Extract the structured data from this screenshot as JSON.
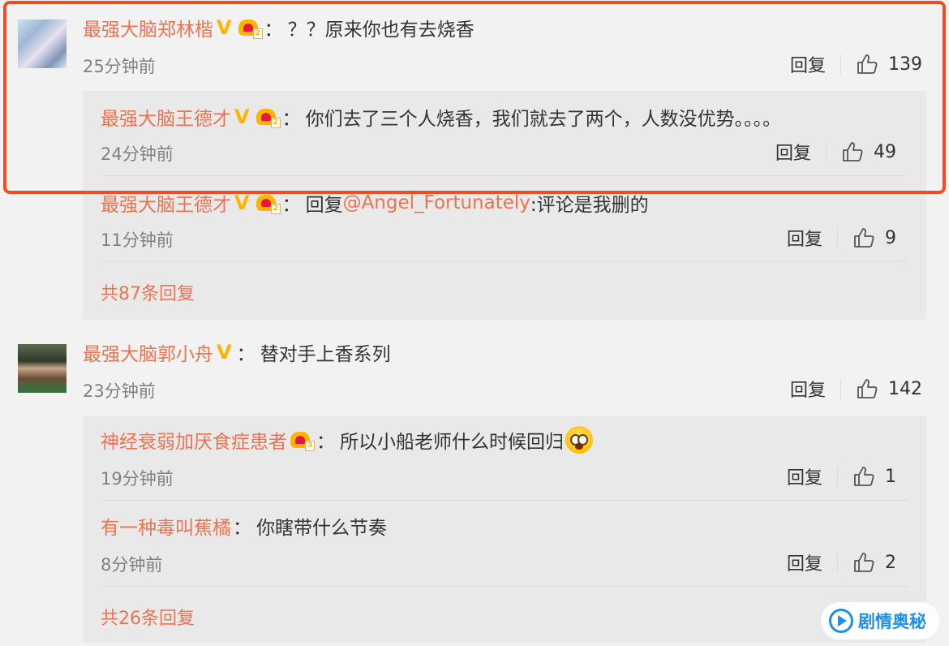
{
  "ui": {
    "reply_label": "回复",
    "colon": "："
  },
  "comments": [
    {
      "user": "最强大脑郑林楷",
      "text": "？？原来你也有去烧香",
      "time": "25分钟前",
      "likes": "139",
      "badges": [
        "v-badge",
        "crown-lv2-icon"
      ],
      "replies": [
        {
          "user": "最强大脑王德才",
          "text": "你们去了三个人烧香，我们就去了两个，人数没优势。。。。",
          "time": "24分钟前",
          "likes": "49"
        },
        {
          "user": "最强大脑王德才",
          "reply_prefix": "回复",
          "mention": "@Angel_Fortunately",
          "text": ":评论是我删的",
          "time": "11分钟前",
          "likes": "9"
        }
      ],
      "more": "共87条回复"
    },
    {
      "user": "最强大脑郭小舟",
      "text": "替对手上香系列",
      "time": "23分钟前",
      "likes": "142",
      "badges": [
        "v-badge"
      ],
      "replies": [
        {
          "user": "神经衰弱加厌食症患者",
          "text": "所以小船老师什么时候回归",
          "time": "19分钟前",
          "likes": "1",
          "emoji": "scared-face-icon"
        },
        {
          "user": "有一种毒叫蕉橘",
          "text": "你瞎带什么节奏",
          "time": "8分钟前",
          "likes": "2"
        }
      ],
      "more": "共26条回复"
    }
  ],
  "watermark": {
    "text": "剧情奥秘"
  },
  "colors": {
    "name": "#eb7350",
    "highlight_border": "#f24a23",
    "verified": "#ffb400",
    "watermark": "#1e90e6"
  }
}
